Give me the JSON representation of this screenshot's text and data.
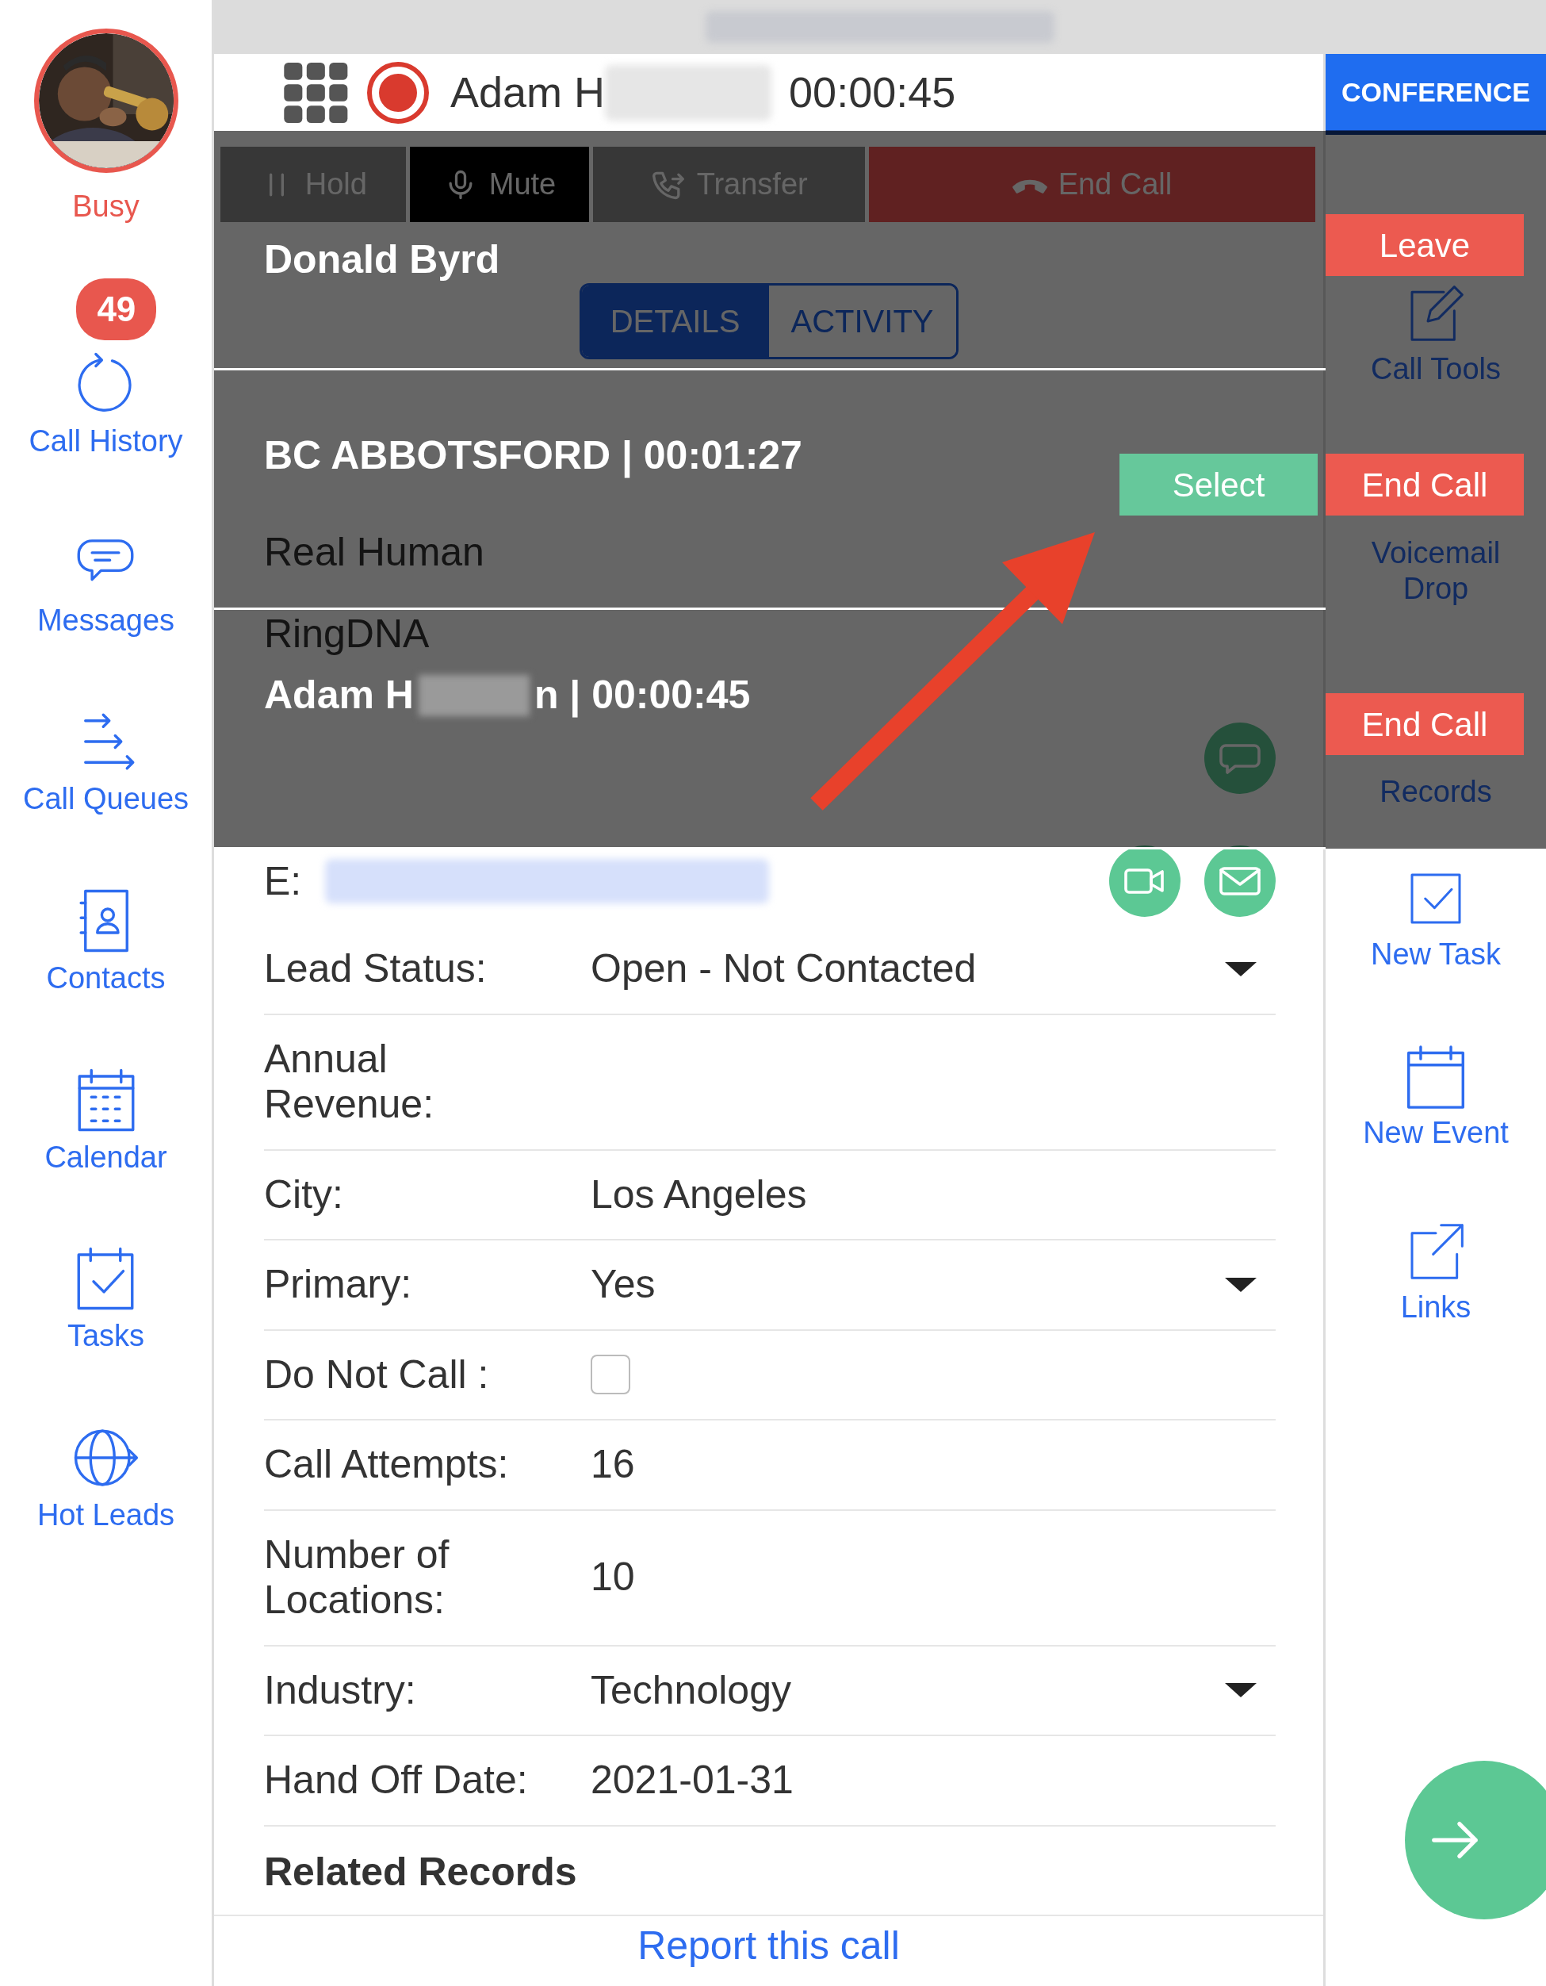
{
  "call_header": {
    "caller_name": "Adam H",
    "timer": "00:00:45"
  },
  "conference_button": "CONFERENCE",
  "user": {
    "status": "Busy"
  },
  "nav": [
    {
      "label": "Call History",
      "kind": "history",
      "badge": "49"
    },
    {
      "label": "Messages",
      "kind": "messages"
    },
    {
      "label": "Call Queues",
      "kind": "queues"
    },
    {
      "label": "Contacts",
      "kind": "contacts"
    },
    {
      "label": "Calendar",
      "kind": "calendar"
    },
    {
      "label": "Tasks",
      "kind": "tasks"
    },
    {
      "label": "Hot Leads",
      "kind": "hotleads"
    }
  ],
  "call_controls": [
    {
      "label": "Hold",
      "kind": "hold"
    },
    {
      "label": "Mute",
      "kind": "mute"
    },
    {
      "label": "Transfer",
      "kind": "transfer"
    },
    {
      "label": "End Call",
      "kind": "end"
    }
  ],
  "tabs": [
    {
      "label": "DETAILS",
      "selected": true
    },
    {
      "label": "ACTIVITY",
      "selected": false
    }
  ],
  "contact": {
    "disposition": "Real Human",
    "source": "RingDNA",
    "email_label": "E:"
  },
  "fields": [
    {
      "label": "Lead Status:",
      "value": "Open - Not Contacted",
      "kind": "dropdown"
    },
    {
      "label": "Annual Revenue:",
      "kind": "text"
    },
    {
      "label": "City:",
      "value": "Los Angeles",
      "kind": "text"
    },
    {
      "label": "Primary:",
      "value": "Yes",
      "kind": "dropdown"
    },
    {
      "label": "Do Not Call :",
      "kind": "checkbox",
      "checked": false
    },
    {
      "label": "Call Attempts:",
      "value": "16",
      "kind": "text"
    },
    {
      "label": "Number of Locations:",
      "value": "10",
      "kind": "text"
    },
    {
      "label": "Industry:",
      "value": "Technology",
      "kind": "dropdown"
    },
    {
      "label": "Hand Off Date:",
      "value": "2021-01-31",
      "kind": "text"
    }
  ],
  "related_records": {
    "heading": "Related Records",
    "report_link": "Report this call"
  },
  "tools": [
    {
      "label": "Call Tools",
      "kind": "edit"
    },
    {
      "label": "Voicemail Drop",
      "kind": "voicemail"
    },
    {
      "label": "Records",
      "kind": "records"
    },
    {
      "label": "New Task",
      "kind": "task"
    },
    {
      "label": "New Event",
      "kind": "event"
    },
    {
      "label": "Links",
      "kind": "link"
    }
  ],
  "conference_calls": [
    {
      "title": [
        "Donald Byrd"
      ],
      "actions": [
        {
          "label": "Leave",
          "kind": "leave"
        }
      ]
    },
    {
      "title": [
        "BC ABBOTSFORD | 00:01:27"
      ],
      "actions": [
        {
          "label": "Select",
          "kind": "select"
        },
        {
          "label": "End Call",
          "kind": "end"
        }
      ]
    },
    {
      "title": [
        "Adam H",
        "n | 00:00:45"
      ],
      "actions": [
        {
          "label": "End Call",
          "kind": "end"
        }
      ]
    }
  ]
}
